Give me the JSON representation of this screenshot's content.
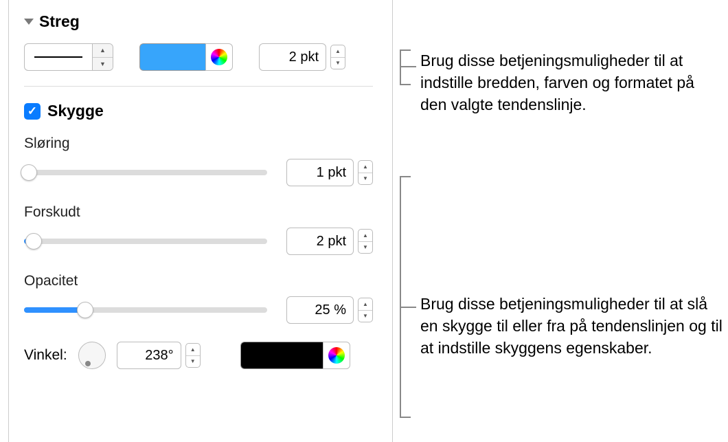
{
  "streg": {
    "title": "Streg",
    "width_value": "2 pkt"
  },
  "skygge": {
    "label": "Skygge",
    "checked": true,
    "sloring": {
      "label": "Sløring",
      "value": "1 pkt",
      "percent": 2
    },
    "forskudt": {
      "label": "Forskudt",
      "value": "2 pkt",
      "percent": 4
    },
    "opacitet": {
      "label": "Opacitet",
      "value": "25 %",
      "percent": 25
    }
  },
  "vinkel": {
    "label": "Vinkel:",
    "value": "238°"
  },
  "annotations": {
    "top": "Brug disse betjeningsmuligheder til at indstille bredden, farven og formatet på den valgte tendenslinje.",
    "bottom": "Brug disse betjeningsmuligheder til at slå en skygge til eller fra på tendenslinjen og til at indstille skyggens egenskaber."
  }
}
